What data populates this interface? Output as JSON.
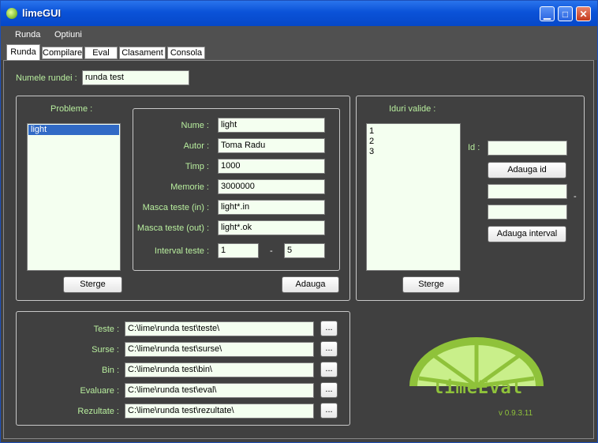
{
  "window": {
    "title": "limeGUI",
    "minimize": "0",
    "maximize": "1",
    "close": "x"
  },
  "menu": [
    "Runda",
    "Optiuni"
  ],
  "tabs": [
    "Runda",
    "Compilare",
    "Eval",
    "Clasament",
    "Consola"
  ],
  "round": {
    "label": "Numele rundei :",
    "value": "runda test"
  },
  "problems": {
    "title": "Probleme :",
    "items": [
      "light"
    ],
    "delete_label": "Sterge",
    "fields": {
      "name_label": "Nume :",
      "name_value": "light",
      "author_label": "Autor :",
      "author_value": "Toma Radu",
      "time_label": "Timp :",
      "time_value": "1000",
      "memory_label": "Memorie :",
      "memory_value": "3000000",
      "mask_in_label": "Masca teste (in) :",
      "mask_in_value": "light*.in",
      "mask_out_label": "Masca teste (out) :",
      "mask_out_value": "light*.ok",
      "interval_label": "Interval teste  :",
      "interval_from": "1",
      "interval_dash": "-",
      "interval_to": "5"
    },
    "add_label": "Adauga"
  },
  "ids": {
    "title": "Iduri valide :",
    "items": [
      "1",
      "2",
      "3"
    ],
    "delete_label": "Sterge",
    "id_label": "Id :",
    "id_value": "",
    "add_id_label": "Adauga id",
    "interval_from": "",
    "interval_to": "",
    "interval_dash": "-",
    "add_interval_label": "Adauga interval"
  },
  "paths": [
    {
      "label": "Teste :",
      "value": "C:\\lime\\runda test\\teste\\"
    },
    {
      "label": "Surse :",
      "value": "C:\\lime\\runda test\\surse\\"
    },
    {
      "label": "Bin :",
      "value": "C:\\lime\\runda test\\bin\\"
    },
    {
      "label": "Evaluare :",
      "value": "C:\\lime\\runda test\\eval\\"
    },
    {
      "label": "Rezultate :",
      "value": "C:\\lime\\runda test\\rezultate\\"
    }
  ],
  "browse_label": "...",
  "logo": {
    "text": "limeEval",
    "version": "v 0.9.3.11"
  },
  "colors": {
    "label_green": "#b8ee9e",
    "background": "#404040",
    "selection": "#316ac5"
  }
}
